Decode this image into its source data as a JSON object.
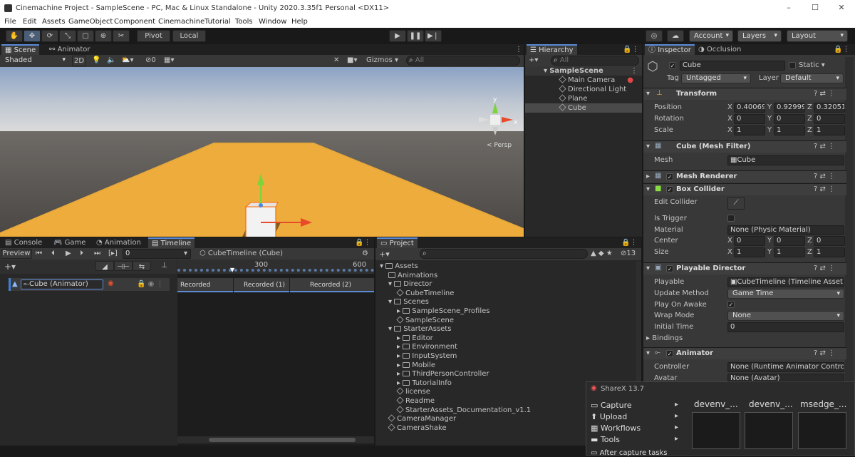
{
  "window": {
    "title": "Cinemachine Project - SampleScene - PC, Mac & Linux Standalone - Unity 2020.3.35f1 Personal <DX11>"
  },
  "menu": [
    "File",
    "Edit",
    "Assets",
    "GameObject",
    "Component",
    "Cinemachine",
    "Tutorial",
    "Tools",
    "Window",
    "Help"
  ],
  "toolbar": {
    "pivot": "Pivot",
    "local": "Local",
    "account": "Account",
    "layers": "Layers",
    "layout": "Layout"
  },
  "scene": {
    "tabs": [
      "Scene",
      "Animator"
    ],
    "shading": "Shaded",
    "mode2d": "2D",
    "gizmos": "Gizmos",
    "search_placeholder": "All",
    "fx_count": "0",
    "persp": "< Persp"
  },
  "hierarchy": {
    "tab": "Hierarchy",
    "search_placeholder": "All",
    "root": "SampleScene",
    "items": [
      "Main Camera",
      "Directional Light",
      "Plane",
      "Cube"
    ]
  },
  "inspector": {
    "tabs": [
      "Inspector",
      "Occlusion"
    ],
    "object_name": "Cube",
    "static_label": "Static",
    "tag_label": "Tag",
    "tag_value": "Untagged",
    "layer_label": "Layer",
    "layer_value": "Default",
    "transform": {
      "title": "Transform",
      "position": "Position",
      "rotation": "Rotation",
      "scale": "Scale",
      "pos": [
        "0.40069",
        "0.929995",
        "0.32051"
      ],
      "rot": [
        "0",
        "0",
        "0"
      ],
      "scl": [
        "1",
        "1",
        "1"
      ]
    },
    "mesh_filter": {
      "title": "Cube (Mesh Filter)",
      "mesh_label": "Mesh",
      "mesh_value": "Cube"
    },
    "mesh_renderer": {
      "title": "Mesh Renderer"
    },
    "box_collider": {
      "title": "Box Collider",
      "edit": "Edit Collider",
      "trigger": "Is Trigger",
      "material": "Material",
      "material_value": "None (Physic Material)",
      "center": "Center",
      "center_vals": [
        "0",
        "0",
        "0"
      ],
      "size": "Size",
      "size_vals": [
        "1",
        "1",
        "1"
      ]
    },
    "playable_director": {
      "title": "Playable Director",
      "playable": "Playable",
      "playable_value": "CubeTimeline (Timeline Asset)",
      "update": "Update Method",
      "update_value": "Game Time",
      "play_on_awake": "Play On Awake",
      "wrap": "Wrap Mode",
      "wrap_value": "None",
      "initial": "Initial Time",
      "initial_value": "0",
      "bindings": "Bindings"
    },
    "animator": {
      "title": "Animator",
      "controller": "Controller",
      "controller_value": "None (Runtime Animator Controll",
      "avatar": "Avatar",
      "avatar_value": "None (Avatar)"
    }
  },
  "timeline": {
    "tabs": [
      "Console",
      "Game",
      "Animation",
      "Timeline"
    ],
    "preview": "Preview",
    "frame": "0",
    "asset": "CubeTimeline (Cube)",
    "track": "Cube (Animator)",
    "ticks": [
      "300",
      "600"
    ],
    "clips": [
      "Recorded",
      "Recorded (1)",
      "Recorded (2)"
    ]
  },
  "project": {
    "tab": "Project",
    "count": "13",
    "tree": [
      {
        "t": "Assets",
        "d": 0,
        "k": "folder"
      },
      {
        "t": "Animations",
        "d": 1,
        "k": "folder"
      },
      {
        "t": "Director",
        "d": 1,
        "k": "folder"
      },
      {
        "t": "CubeTimeline",
        "d": 2,
        "k": "file"
      },
      {
        "t": "Scenes",
        "d": 1,
        "k": "folder"
      },
      {
        "t": "SampleScene_Profiles",
        "d": 2,
        "k": "folder"
      },
      {
        "t": "SampleScene",
        "d": 2,
        "k": "file"
      },
      {
        "t": "StarterAssets",
        "d": 1,
        "k": "folder"
      },
      {
        "t": "Editor",
        "d": 2,
        "k": "folder"
      },
      {
        "t": "Environment",
        "d": 2,
        "k": "folder"
      },
      {
        "t": "InputSystem",
        "d": 2,
        "k": "folder"
      },
      {
        "t": "Mobile",
        "d": 2,
        "k": "folder"
      },
      {
        "t": "ThirdPersonController",
        "d": 2,
        "k": "folder"
      },
      {
        "t": "TutorialInfo",
        "d": 2,
        "k": "folder"
      },
      {
        "t": "license",
        "d": 2,
        "k": "file"
      },
      {
        "t": "Readme",
        "d": 2,
        "k": "file"
      },
      {
        "t": "StarterAssets_Documentation_v1.1",
        "d": 2,
        "k": "file"
      },
      {
        "t": "CameraManager",
        "d": 1,
        "k": "file"
      },
      {
        "t": "CameraShake",
        "d": 1,
        "k": "file"
      }
    ]
  },
  "sharex": {
    "title": "ShareX 13.7",
    "menu": [
      "Capture",
      "Upload",
      "Workflows",
      "Tools",
      "After capture tasks"
    ],
    "thumbs": [
      "devenv_...",
      "devenv_...",
      "msedge_..."
    ]
  }
}
